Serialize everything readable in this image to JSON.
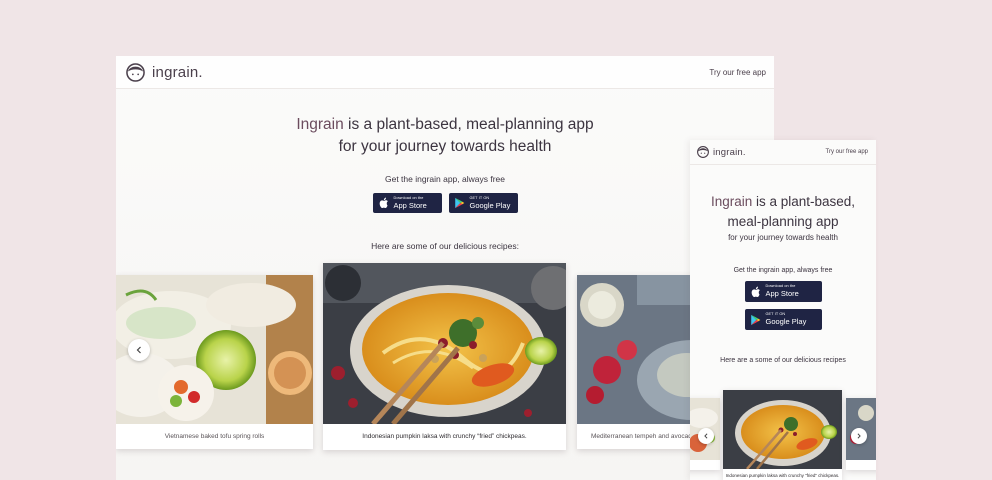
{
  "brand": {
    "name": "ingrain."
  },
  "nav": {
    "cta": "Try our free app"
  },
  "hero": {
    "brand_word": "Ingrain",
    "line1_rest": " is a plant-based, meal-planning app",
    "line2": "for your journey towards health",
    "mobile_line1_rest": " is a plant-based,",
    "mobile_line2": "meal-planning app",
    "mobile_tagline": "for your journey towards health"
  },
  "download": {
    "label": "Get the ingrain app, always free",
    "app_store_small": "Download on the",
    "app_store_big": "App Store",
    "google_play_small": "GET IT ON",
    "google_play_big": "Google Play"
  },
  "recipes": {
    "title": "Here are some of our delicious recipes:",
    "mobile_title": "Here are a some of our delicious recipes",
    "items": [
      "Vietnamese baked tofu spring rolls",
      "Indonesian pumpkin laksa with crunchy “fried” chickpeas.",
      "Mediterranean tempeh and avocado"
    ]
  },
  "icons": {
    "logo": "ingrain-face-logo-icon",
    "apple": "apple-icon",
    "play": "google-play-icon",
    "prev": "chevron-left-icon",
    "next": "chevron-right-icon"
  },
  "colors": {
    "background": "#f0e5e7",
    "accent": "#6b4c5e",
    "store_button": "#1f2444",
    "text": "#3c3440"
  }
}
